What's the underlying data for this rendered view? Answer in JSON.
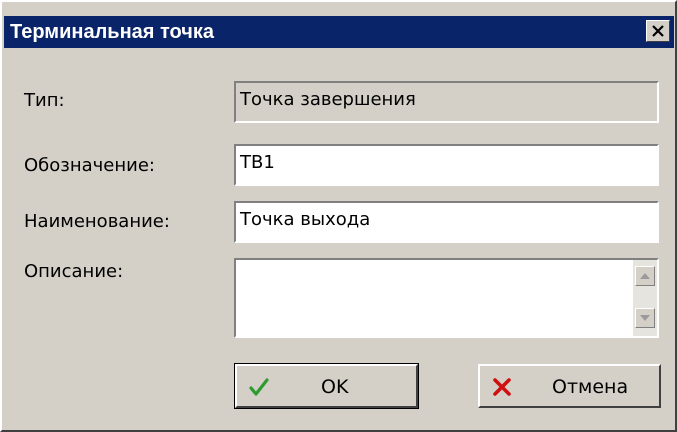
{
  "dialog": {
    "title": "Терминальная точка"
  },
  "form": {
    "type_label": "Тип:",
    "type_value": "Точка завершения",
    "designation_label": "Обозначение:",
    "designation_value": "ТВ1",
    "name_label": "Наименование:",
    "name_value": "Точка выхода",
    "description_label": "Описание:",
    "description_value": ""
  },
  "buttons": {
    "ok_label": "OK",
    "cancel_label": "Отмена"
  },
  "icons": {
    "close": "close-icon",
    "ok": "checkmark-icon",
    "cancel": "red-x-icon",
    "scroll_up": "arrow-up-icon",
    "scroll_down": "arrow-down-icon"
  },
  "colors": {
    "titlebar": "#0a246a",
    "dialog_bg": "#d4d0c8",
    "ok_icon": "#2e9b2e",
    "cancel_icon": "#d01010"
  }
}
